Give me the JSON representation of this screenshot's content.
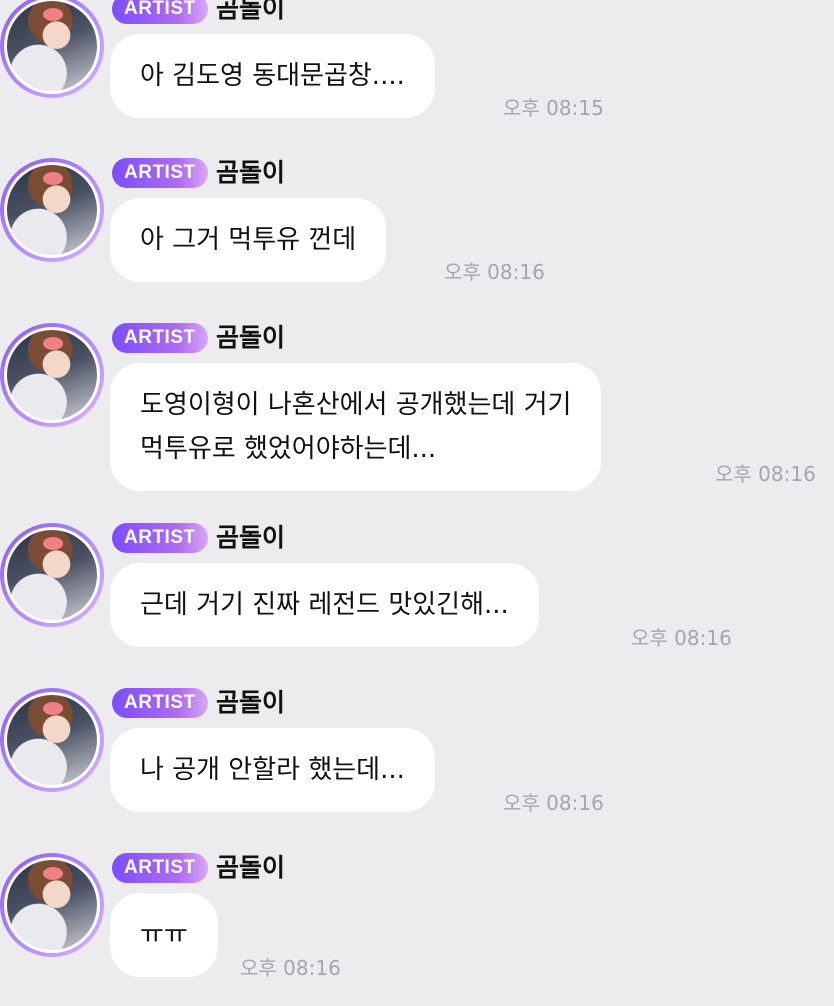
{
  "badge_label": "ARTIST",
  "sender_name": "곰돌이",
  "messages": [
    {
      "text": "아 김도영 동대문곱창....",
      "time": "오후 08:15"
    },
    {
      "text": "아 그거 먹투유 껀데",
      "time": "오후 08:16"
    },
    {
      "line1": "도영이형이 나혼산에서 공개했는데 거기",
      "line2": "먹투유로 했었어야하는데...",
      "time": "오후 08:16"
    },
    {
      "text": "근데 거기 진짜 레전드 맛있긴해...",
      "time": "오후 08:16"
    },
    {
      "text": "나 공개 안할라 했는데...",
      "time": "오후 08:16"
    },
    {
      "text": "ㅠㅠ",
      "time": "오후 08:16"
    }
  ],
  "colors": {
    "badge_start": "#7c4dff",
    "badge_end": "#d9a7f7",
    "background": "#ececef",
    "bubble": "#ffffff",
    "timestamp": "#a5a5ab"
  }
}
